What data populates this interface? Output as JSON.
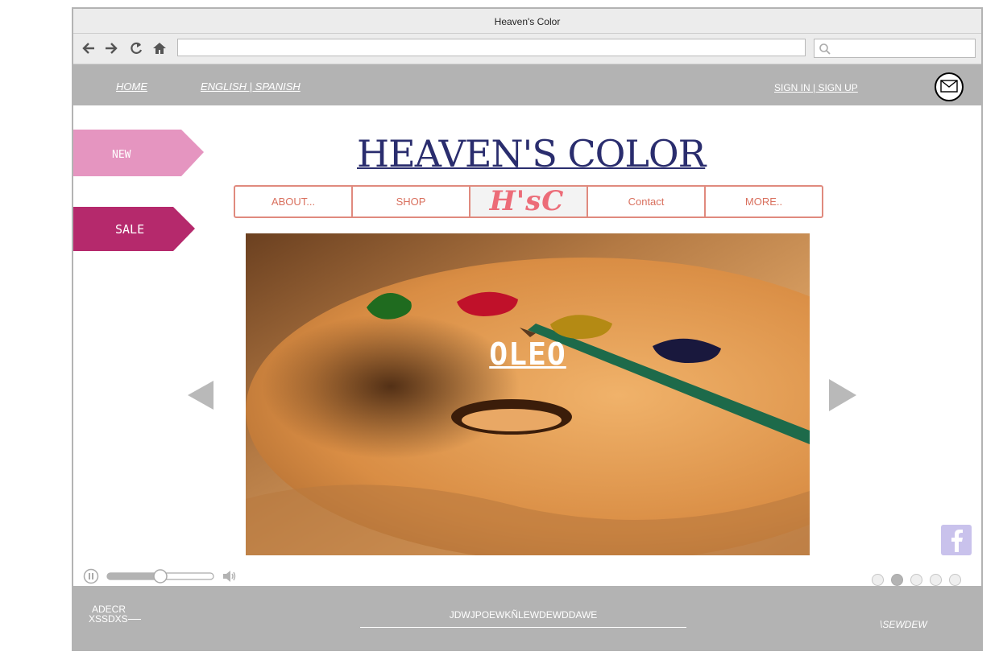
{
  "window": {
    "title": "Heaven's Color"
  },
  "browser": {
    "back_icon": "arrow-left-icon",
    "forward_icon": "arrow-right-icon",
    "reload_icon": "reload-icon",
    "home_icon": "home-icon",
    "address_value": "",
    "search_value": "",
    "search_icon": "magnifier-icon"
  },
  "topbar": {
    "home_link": "HOME",
    "language_link": "ENGLISH | SPANISH",
    "sign_links": "SIGN IN |  SIGN UP",
    "mail_icon": "envelope-icon"
  },
  "tags": [
    {
      "label": "NEW",
      "color": "#e595c0"
    },
    {
      "label": "SALE",
      "color": "#b5296c"
    }
  ],
  "brand": {
    "title": "HEAVEN'S COLOR",
    "color": "#2a2d6e"
  },
  "menu": {
    "items": [
      "ABOUT...",
      "SHOP",
      "Contact",
      "MORE.."
    ],
    "logo_text": "H'sC",
    "accent": "#e08a7e"
  },
  "hero": {
    "caption": "OLEO"
  },
  "carousel": {
    "prev_icon": "triangle-left-icon",
    "next_icon": "triangle-right-icon",
    "active_slide": 2,
    "slide_count": 5
  },
  "player": {
    "pause_icon": "pause-icon",
    "volume_icon": "speaker-icon",
    "volume_level": 0.5
  },
  "social": {
    "facebook_icon": "facebook-icon"
  },
  "footer": {
    "left_line1": "ADECR",
    "left_line2": "XSSDXS",
    "center": "JDWJPOEWKÑLEWDEWDDAWE",
    "right": "\\SEWDEW"
  }
}
